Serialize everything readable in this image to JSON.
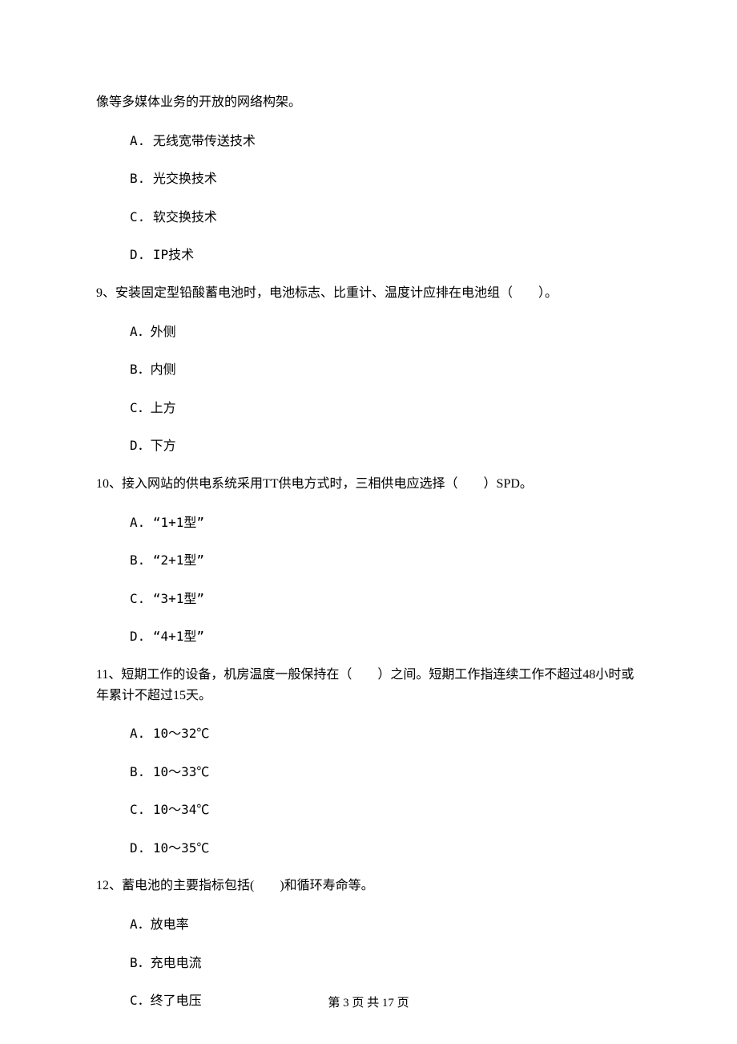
{
  "intro_continued": "像等多媒体业务的开放的网络构架。",
  "q8": {
    "options": {
      "A": "A. 无线宽带传送技术",
      "B": "B. 光交换技术",
      "C": "C. 软交换技术",
      "D": "D. IP技术"
    }
  },
  "q9": {
    "stem": "9、安装固定型铅酸蓄电池时，电池标志、比重计、温度计应排在电池组（　　）。",
    "options": {
      "A": "A．外侧",
      "B": "B．内侧",
      "C": "C．上方",
      "D": "D．下方"
    }
  },
  "q10": {
    "stem": "10、接入网站的供电系统采用TT供电方式时，三相供电应选择（　　）SPD。",
    "options": {
      "A": "A. “1+1型”",
      "B": "B. “2+1型”",
      "C": "C. “3+1型”",
      "D": "D. “4+1型”"
    }
  },
  "q11": {
    "stem": "11、短期工作的设备，机房温度一般保持在（　　）之间。短期工作指连续工作不超过48小时或年累计不超过15天。",
    "options": {
      "A": "A. 10～32℃",
      "B": "B. 10～33℃",
      "C": "C. 10～34℃",
      "D": "D. 10～35℃"
    }
  },
  "q12": {
    "stem": "12、蓄电池的主要指标包括(　　)和循环寿命等。",
    "options": {
      "A": "A．放电率",
      "B": "B．充电电流",
      "C": "C．终了电压"
    }
  },
  "footer": "第 3 页 共 17 页"
}
